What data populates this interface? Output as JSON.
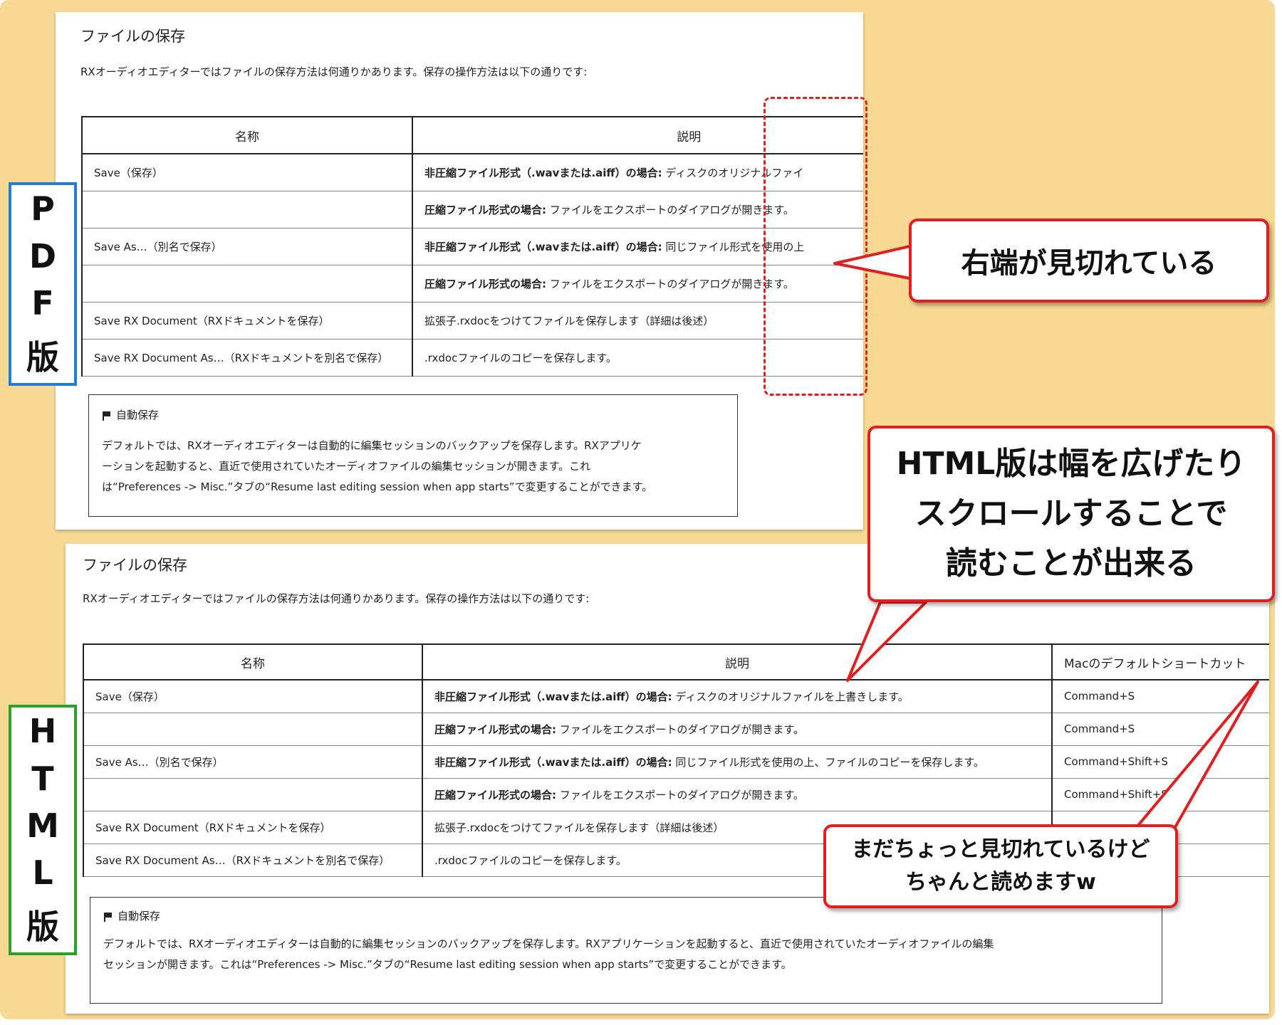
{
  "pdf": {
    "title": "ファイルの保存",
    "intro": "RXオーディオエディターではファイルの保存方法は何通りかあります。保存の操作方法は以下の通りです:",
    "headers": [
      "名称",
      "説明"
    ],
    "rows": [
      {
        "name": "Save（保存）",
        "desc_bold": "非圧縮ファイル形式（.wavまたは.aiff）の場合:",
        "desc": " ディスクのオリジナルファイ"
      },
      {
        "name": "",
        "desc_bold": "圧縮ファイル形式の場合:",
        "desc": " ファイルをエクスポートのダイアログが開きます。"
      },
      {
        "name": "Save As…（別名で保存）",
        "desc_bold": "非圧縮ファイル形式（.wavまたは.aiff）の場合:",
        "desc": " 同じファイル形式を使用の上"
      },
      {
        "name": "",
        "desc_bold": "圧縮ファイル形式の場合:",
        "desc": " ファイルをエクスポートのダイアログが開きます。"
      },
      {
        "name": "Save RX Document（RXドキュメントを保存）",
        "desc_bold": "",
        "desc": "拡張子.rxdocをつけてファイルを保存します（詳細は後述）"
      },
      {
        "name": "Save RX Document As…（RXドキュメントを別名で保存）",
        "desc_bold": "",
        "desc": ".rxdocファイルのコピーを保存します。"
      }
    ],
    "note": {
      "title": "自動保存",
      "lines": [
        "デフォルトでは、RXオーディオエディターは自動的に編集セッションのバックアップを保存します。RXアプリケ",
        "ーションを起動すると、直近で使用されていたオーディオファイルの編集セッションが開きます。これ",
        "は“Preferences -> Misc.”タブの“Resume last editing session when app starts”で変更することができます。"
      ]
    }
  },
  "html": {
    "title": "ファイルの保存",
    "intro": "RXオーディオエディターではファイルの保存方法は何通りかあります。保存の操作方法は以下の通りです:",
    "headers": [
      "名称",
      "説明",
      "Macのデフォルトショートカット"
    ],
    "rows": [
      {
        "name": "Save（保存）",
        "desc_bold": "非圧縮ファイル形式（.wavまたは.aiff）の場合:",
        "desc": " ディスクのオリジナルファイルを上書きします。",
        "shortcut": "Command+S"
      },
      {
        "name": "",
        "desc_bold": "圧縮ファイル形式の場合:",
        "desc": " ファイルをエクスポートのダイアログが開きます。",
        "shortcut": "Command+S"
      },
      {
        "name": "Save As…（別名で保存）",
        "desc_bold": "非圧縮ファイル形式（.wavまたは.aiff）の場合:",
        "desc": " 同じファイル形式を使用の上、ファイルのコピーを保存します。",
        "shortcut": "Command+Shift+S"
      },
      {
        "name": "",
        "desc_bold": "圧縮ファイル形式の場合:",
        "desc": " ファイルをエクスポートのダイアログが開きます。",
        "shortcut": "Command+Shift+S"
      },
      {
        "name": "Save RX Document（RXドキュメントを保存）",
        "desc_bold": "",
        "desc": "拡張子.rxdocをつけてファイルを保存します（詳細は後述）",
        "shortcut": ""
      },
      {
        "name": "Save RX Document As…（RXドキュメントを別名で保存）",
        "desc_bold": "",
        "desc": ".rxdocファイルのコピーを保存します。",
        "shortcut": ""
      }
    ],
    "note": {
      "title": "自動保存",
      "lines": [
        "デフォルトでは、RXオーディオエディターは自動的に編集セッションのバックアップを保存します。RXアプリケーションを起動すると、直近で使用されていたオーディオファイルの編集",
        "セッションが開きます。これは“Preferences -> Misc.”タブの“Resume last editing session when app starts”で変更することができます。"
      ]
    }
  },
  "labels": {
    "pdf": [
      "P",
      "D",
      "F",
      "版"
    ],
    "html": [
      "H",
      "T",
      "M",
      "L",
      "版"
    ]
  },
  "callouts": {
    "cut_off": "右端が見切れている",
    "html_scroll": [
      "HTML版は幅を広げたり",
      "スクロールすることで",
      "読むことが出来る"
    ],
    "still_cut": [
      "まだちょっと見切れているけど",
      "ちゃんと読めますw"
    ]
  },
  "colors": {
    "background": "#f8d994",
    "pdf_label_border": "#1f7ed0",
    "html_label_border": "#2ca02c",
    "callout_border": "#e02020"
  }
}
